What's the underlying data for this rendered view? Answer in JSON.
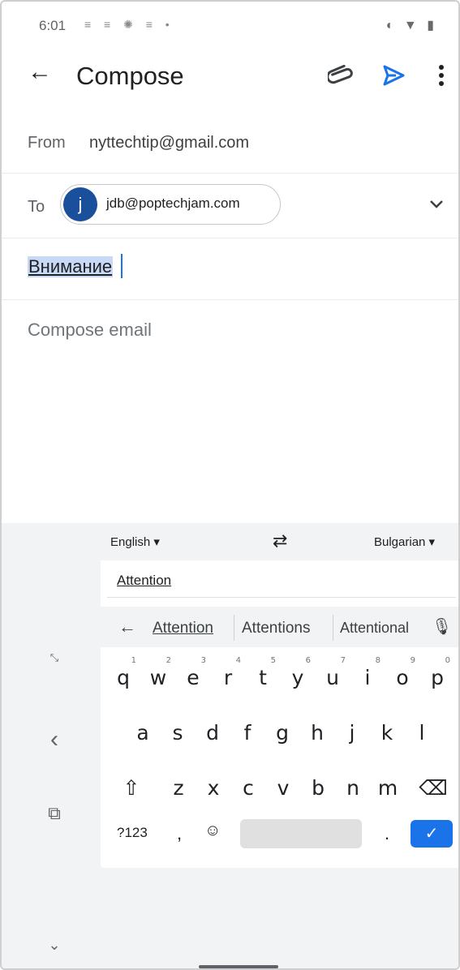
{
  "status_bar": {
    "time": "6:01",
    "notification_icons": "≡ ≡ ✺ ≡ •",
    "system_icons": "◐ ▼ ▮"
  },
  "app_bar": {
    "back_icon": "←",
    "title": "Compose",
    "icons": [
      "attach-icon",
      "send-icon",
      "more-vert-icon"
    ],
    "accent_color": "#1a73e8"
  },
  "from": {
    "label": "From",
    "value": "nyttechtip@gmail.com"
  },
  "to": {
    "label": "To",
    "chip": {
      "avatar_letter": "j",
      "address": "jdb@poptechjam.com",
      "avatar_color": "#1a4f9c"
    },
    "expand_icon": "chevron-down-icon"
  },
  "subject": {
    "value": "Внимание"
  },
  "body": {
    "placeholder": "Compose email"
  },
  "keyboard": {
    "translate": {
      "source_lang": "English ▾",
      "swap_icon": "⇄",
      "target_lang": "Bulgarian ▾",
      "input_text": "Attention"
    },
    "suggestions": {
      "back_icon": "←",
      "items": [
        "Attention",
        "Attentions",
        "Attentional"
      ],
      "mic_icon": "🎙"
    },
    "rows": {
      "row1": [
        "q",
        "w",
        "e",
        "r",
        "t",
        "y",
        "u",
        "i",
        "o",
        "p"
      ],
      "row1_hints": [
        "1",
        "2",
        "3",
        "4",
        "5",
        "6",
        "7",
        "8",
        "9",
        "0"
      ],
      "row2": [
        "a",
        "s",
        "d",
        "f",
        "g",
        "h",
        "j",
        "k",
        "l"
      ],
      "row3": [
        "⇧",
        "z",
        "x",
        "c",
        "v",
        "b",
        "n",
        "m",
        "⌫"
      ]
    },
    "bottom_row": {
      "symbols": "?123",
      "comma": ",",
      "emoji": "☺",
      "period": ".",
      "enter": "✓"
    },
    "side_controls": {
      "expand": "⤡",
      "collapse_left": "‹",
      "float": "⧉",
      "down": "⌄"
    }
  }
}
